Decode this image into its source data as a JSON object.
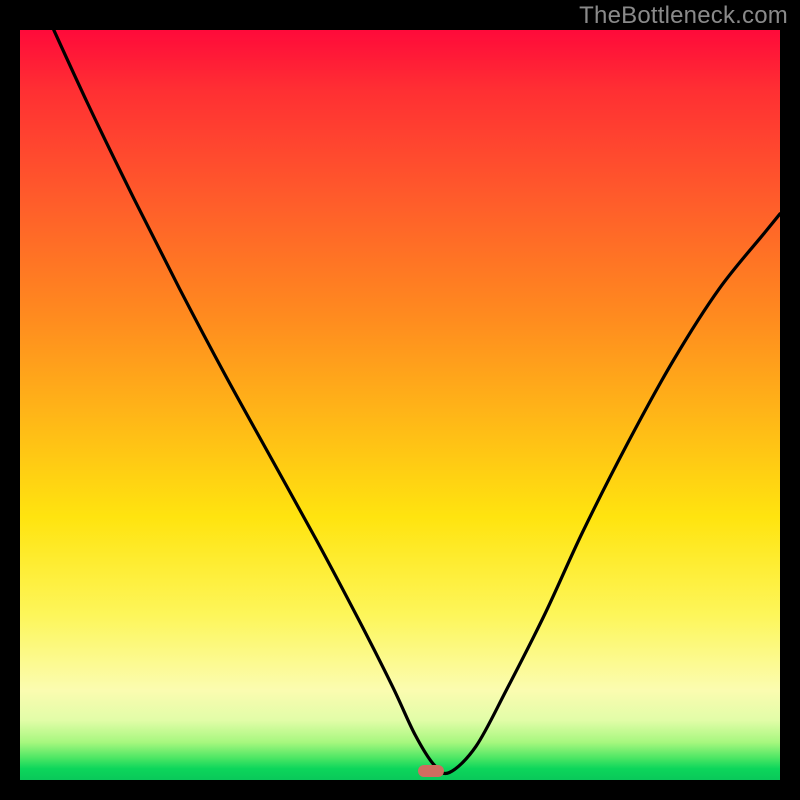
{
  "watermark": "TheBottleneck.com",
  "marker": {
    "x_fraction": 0.538,
    "color": "#cf6d60"
  },
  "chart_data": {
    "type": "line",
    "title": "",
    "xlabel": "",
    "ylabel": "",
    "xlim": [
      0,
      1
    ],
    "ylim": [
      0,
      1
    ],
    "series": [
      {
        "name": "bottleneck-curve",
        "x": [
          0.04,
          0.09,
          0.15,
          0.21,
          0.27,
          0.33,
          0.39,
          0.445,
          0.49,
          0.52,
          0.545,
          0.565,
          0.6,
          0.64,
          0.69,
          0.74,
          0.8,
          0.86,
          0.92,
          0.98,
          1.0
        ],
        "y": [
          1.01,
          0.9,
          0.775,
          0.655,
          0.54,
          0.43,
          0.32,
          0.215,
          0.125,
          0.06,
          0.02,
          0.01,
          0.045,
          0.12,
          0.22,
          0.33,
          0.45,
          0.56,
          0.655,
          0.73,
          0.755
        ]
      }
    ],
    "annotations": [],
    "legend": null,
    "background_gradient": {
      "orientation": "vertical",
      "stops": [
        {
          "pos": 0.0,
          "color": "#ff0a3a"
        },
        {
          "pos": 0.22,
          "color": "#ff5a2b"
        },
        {
          "pos": 0.52,
          "color": "#ffb817"
        },
        {
          "pos": 0.78,
          "color": "#fdf65a"
        },
        {
          "pos": 0.95,
          "color": "#a6f77e"
        },
        {
          "pos": 1.0,
          "color": "#0ac85a"
        }
      ]
    }
  }
}
